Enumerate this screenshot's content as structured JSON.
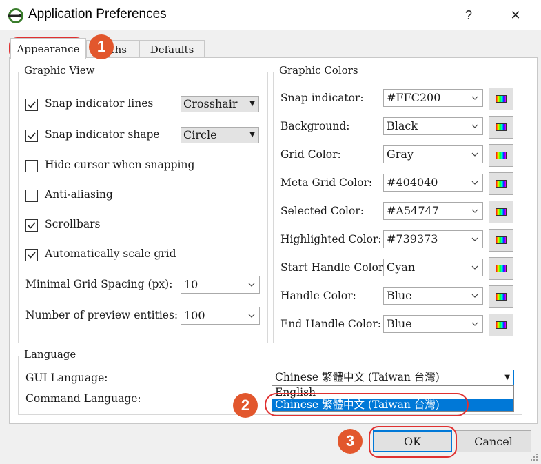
{
  "window": {
    "title": "Application Preferences",
    "help_label": "?",
    "close_label": "✕"
  },
  "tabs": [
    {
      "label": "Appearance",
      "active": true
    },
    {
      "label": "ths",
      "active": false
    },
    {
      "label": "Defaults",
      "active": false
    }
  ],
  "graphic_view": {
    "title": "Graphic View",
    "snap_lines": {
      "label": "Snap indicator lines",
      "checked": true,
      "value": "Crosshair"
    },
    "snap_shape": {
      "label": "Snap indicator shape",
      "checked": true,
      "value": "Circle"
    },
    "hide_cursor": {
      "label": "Hide cursor when snapping",
      "checked": false
    },
    "antialias": {
      "label": "Anti-aliasing",
      "checked": false
    },
    "scrollbars": {
      "label": "Scrollbars",
      "checked": true
    },
    "autoscale": {
      "label": "Automatically scale grid",
      "checked": true
    },
    "min_grid": {
      "label": "Minimal Grid Spacing (px):",
      "value": "10"
    },
    "preview": {
      "label": "Number of preview entities:",
      "value": "100"
    }
  },
  "graphic_colors": {
    "title": "Graphic Colors",
    "rows": [
      {
        "label": "Snap indicator:",
        "value": "#FFC200"
      },
      {
        "label": "Background:",
        "value": "Black"
      },
      {
        "label": "Grid Color:",
        "value": "Gray"
      },
      {
        "label": "Meta Grid Color:",
        "value": "#404040"
      },
      {
        "label": "Selected Color:",
        "value": "#A54747"
      },
      {
        "label": "Highlighted Color:",
        "value": "#739373"
      },
      {
        "label": "Start Handle Color:",
        "value": "Cyan"
      },
      {
        "label": "Handle Color:",
        "value": "Blue"
      },
      {
        "label": "End Handle Color:",
        "value": "Blue"
      }
    ]
  },
  "language": {
    "title": "Language",
    "gui_label": "GUI Language:",
    "gui_value": "Chinese 繁體中文 (Taiwan 台灣)",
    "command_label": "Command Language:",
    "options": [
      "English",
      "Chinese 繁體中文 (Taiwan 台灣)"
    ]
  },
  "buttons": {
    "ok": "OK",
    "cancel": "Cancel"
  },
  "annotations": {
    "step1": "1",
    "step2": "2",
    "step3": "3"
  },
  "colors": {
    "accent": "#0078d7",
    "annotation": "#e2572d",
    "ring": "#e03030"
  }
}
